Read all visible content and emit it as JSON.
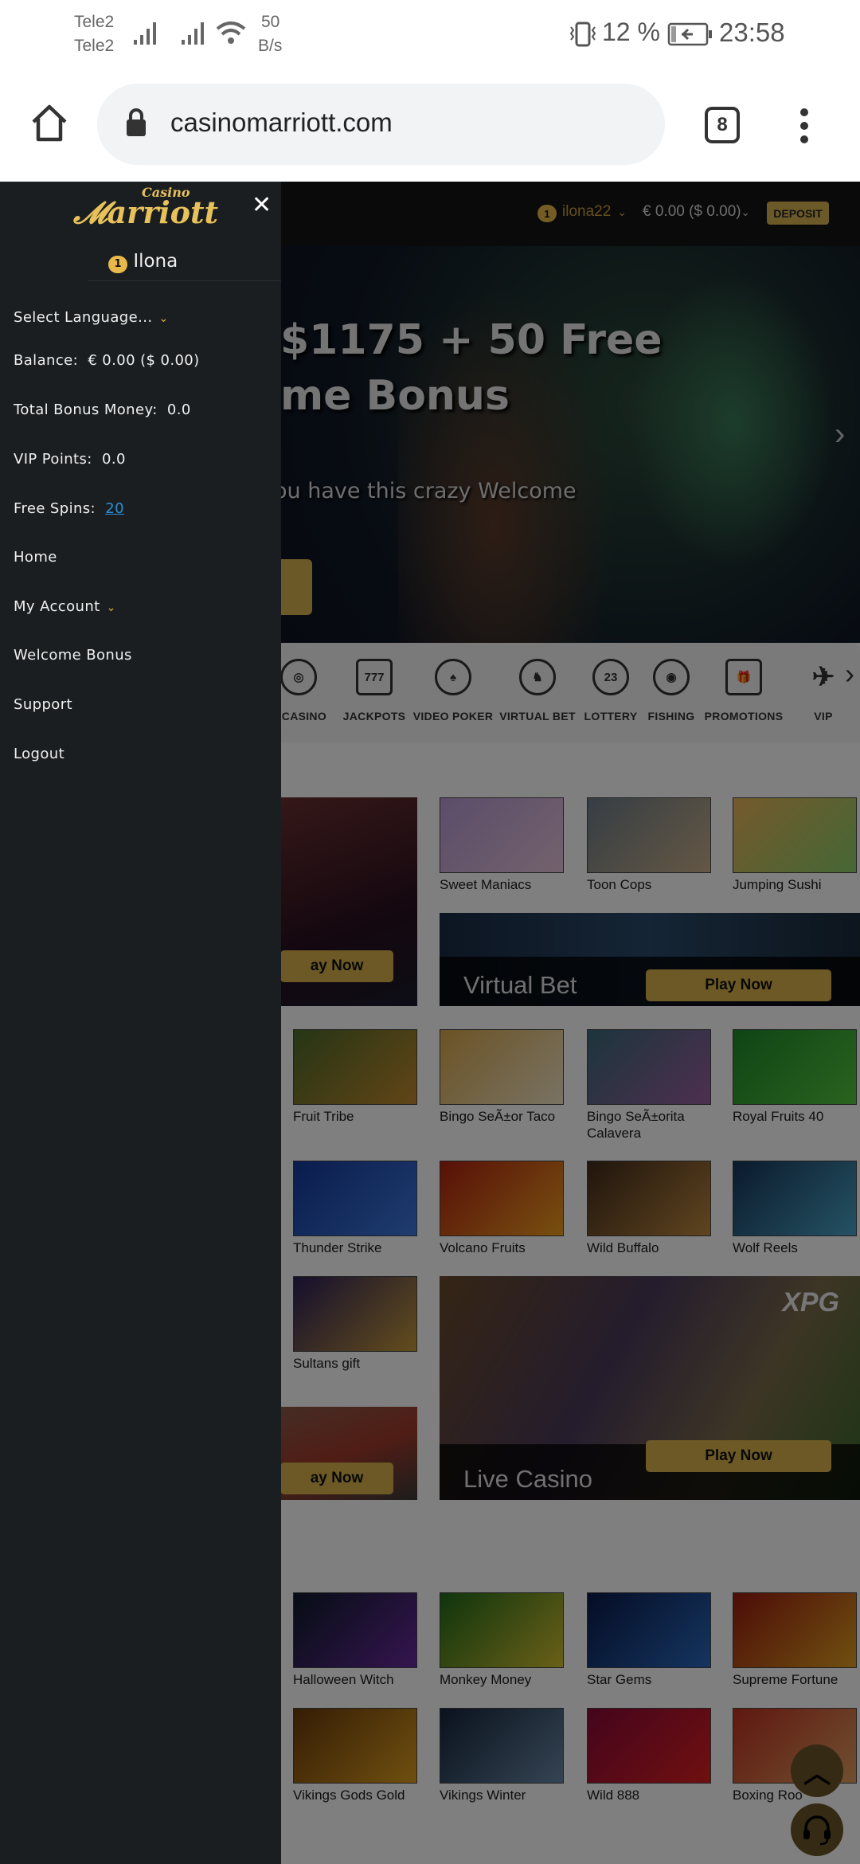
{
  "status_bar": {
    "carrier1": "Tele2",
    "carrier2": "Tele2",
    "net_speed_value": "50",
    "net_speed_unit": "B/s",
    "battery": "12 %",
    "time": "23:58"
  },
  "browser": {
    "url": "casinomarriott.com",
    "tab_count": "8"
  },
  "site_header": {
    "level": "1",
    "username": "ilona22",
    "balance": "€ 0.00 ($ 0.00)",
    "deposit": "DEPOSIT"
  },
  "hero": {
    "line1": "$1175 + 50 Free",
    "line2": "me Bonus",
    "line3": "ou have this crazy Welcome"
  },
  "categories": [
    {
      "label": "E CASINO",
      "icon": "roulette-icon",
      "glyph": "◎"
    },
    {
      "label": "JACKPOTS",
      "icon": "slot-777-icon",
      "glyph": "777"
    },
    {
      "label": "VIDEO POKER",
      "icon": "poker-chip-icon",
      "glyph": "♠"
    },
    {
      "label": "VIRTUAL BET",
      "icon": "horse-icon",
      "glyph": "♞"
    },
    {
      "label": "LOTTERY",
      "icon": "lottery-ball-icon",
      "glyph": "23"
    },
    {
      "label": "FISHING",
      "icon": "target-icon",
      "glyph": "◉"
    },
    {
      "label": "PROMOTIONS",
      "icon": "gift-card-icon",
      "glyph": "🎁"
    },
    {
      "label": "VIP",
      "icon": "airplane-icon",
      "glyph": "✈"
    }
  ],
  "promos": {
    "left_play": "ay Now",
    "virtual_bet_title": "Virtual Bet",
    "virtual_bet_play": "Play Now",
    "live_casino_title": "Live Casino",
    "live_casino_play": "Play Now",
    "xpg_logo": "XPG"
  },
  "game_rows": [
    [
      null,
      {
        "name": "Sweet Maniacs",
        "c1": "#b79ad6",
        "c2": "#e7c4d8"
      },
      {
        "name": "Toon Cops",
        "c1": "#6d7c88",
        "c2": "#c9b08a"
      },
      {
        "name": "Jumping Sushi",
        "c1": "#e9b35a",
        "c2": "#8ccf6a"
      }
    ],
    [
      {
        "name": "Fruit Tribe",
        "c1": "#4d6b2a",
        "c2": "#c48a2d"
      },
      {
        "name": "Bingo SeÃ±or Taco",
        "c1": "#d8a64a",
        "c2": "#f2e6c8"
      },
      {
        "name": "Bingo SeÃ±orita Calavera",
        "c1": "#3b6a7a",
        "c2": "#9b5fa0"
      },
      {
        "name": "Royal Fruits 40",
        "c1": "#1d8a2b",
        "c2": "#55c63e"
      }
    ],
    [
      {
        "name": "Thunder Strike",
        "c1": "#143a9a",
        "c2": "#3e79e0"
      },
      {
        "name": "Volcano Fruits",
        "c1": "#b02010",
        "c2": "#f0a020"
      },
      {
        "name": "Wild Buffalo",
        "c1": "#402a1a",
        "c2": "#c08a40"
      },
      {
        "name": "Wolf Reels",
        "c1": "#16355a",
        "c2": "#4aa6c8"
      }
    ],
    [
      {
        "name": "Sultans gift",
        "c1": "#2a1f5a",
        "c2": "#c79a3a"
      }
    ],
    [
      {
        "name": "Halloween Witch",
        "c1": "#0d1a2a",
        "c2": "#6a2aa0"
      },
      {
        "name": "Monkey Money",
        "c1": "#1f6a1a",
        "c2": "#d4c030"
      },
      {
        "name": "Star Gems",
        "c1": "#0a1a4a",
        "c2": "#2a6ac0"
      },
      {
        "name": "Supreme Fortune",
        "c1": "#9a1a10",
        "c2": "#e0a020"
      }
    ],
    [
      {
        "name": "Vikings Gods Gold",
        "c1": "#6a3a0a",
        "c2": "#e0a020"
      },
      {
        "name": "Vikings Winter",
        "c1": "#14243a",
        "c2": "#6a88a8"
      },
      {
        "name": "Wild 888",
        "c1": "#8a0a3a",
        "c2": "#e02020"
      },
      {
        "name": "Boxing Roo",
        "c1": "#c03020",
        "c2": "#e0a060"
      }
    ]
  ],
  "drawer": {
    "logo": "Casino Marriott",
    "level": "1",
    "name": "Ilona",
    "select_language": "Select Language...",
    "balance_label": "Balance:",
    "balance_value": "€ 0.00 ($ 0.00)",
    "bonus_label": "Total Bonus Money:",
    "bonus_value": "0.0",
    "vip_label": "VIP Points:",
    "vip_value": "0.0",
    "spins_label": "Free Spins:",
    "spins_value": "20",
    "home": "Home",
    "my_account": "My Account",
    "welcome_bonus": "Welcome Bonus",
    "support": "Support",
    "logout": "Logout"
  },
  "colors": {
    "gold": "#d9b24a",
    "drawer_bg": "#1b1e21",
    "link": "#2a8fd8"
  }
}
